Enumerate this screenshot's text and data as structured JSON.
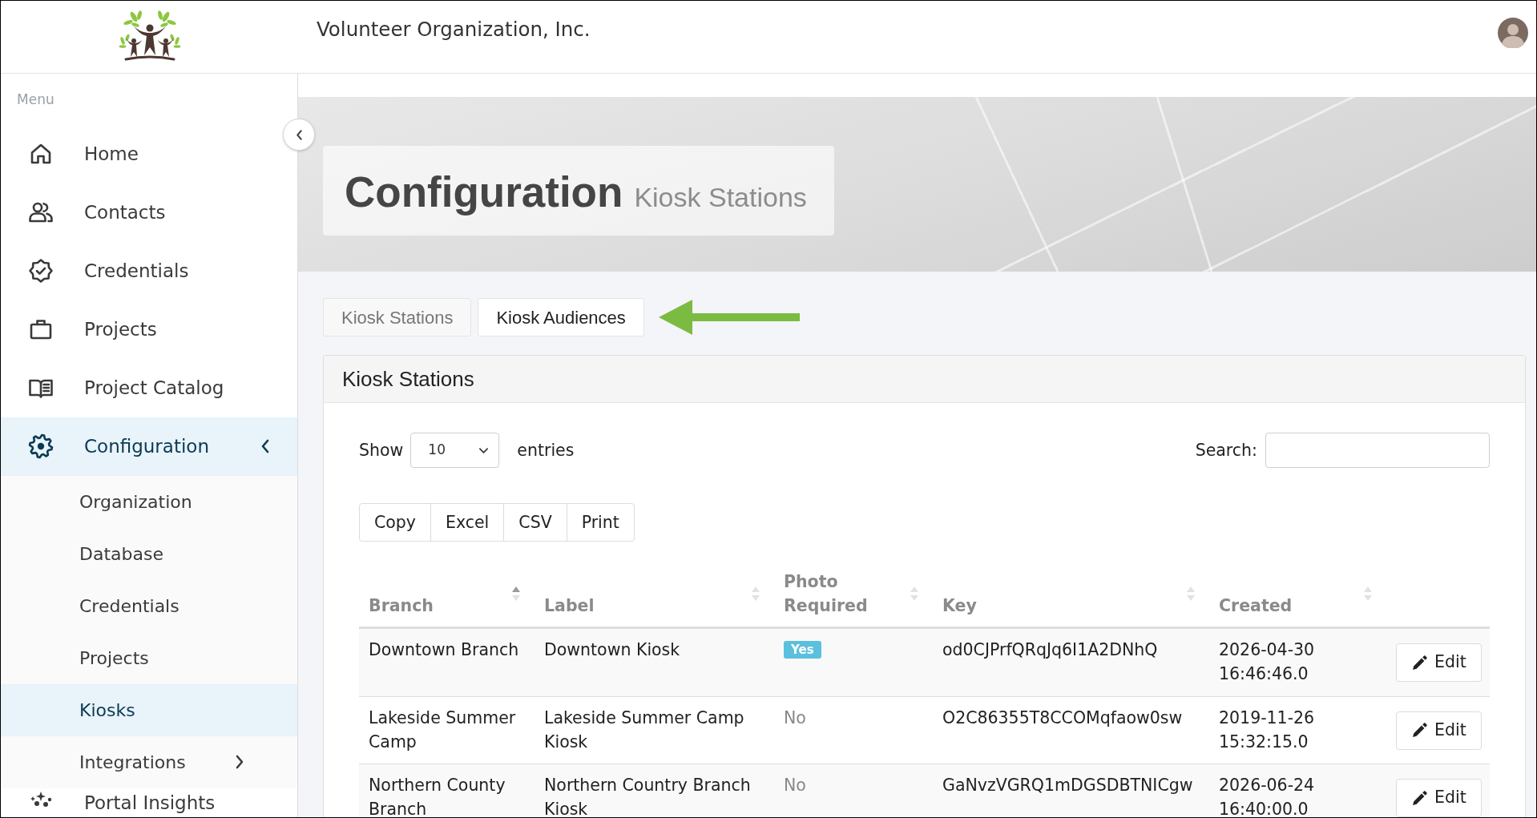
{
  "header": {
    "organization": "Volunteer Organization, Inc."
  },
  "sidebar": {
    "heading": "Menu",
    "items": [
      {
        "label": "Home",
        "selected": false
      },
      {
        "label": "Contacts",
        "selected": false
      },
      {
        "label": "Credentials",
        "selected": false
      },
      {
        "label": "Projects",
        "selected": false
      },
      {
        "label": "Project Catalog",
        "selected": false
      },
      {
        "label": "Configuration",
        "selected": true,
        "expanded": true,
        "children": [
          {
            "label": "Organization",
            "selected": false
          },
          {
            "label": "Database",
            "selected": false
          },
          {
            "label": "Credentials",
            "selected": false
          },
          {
            "label": "Projects",
            "selected": false
          },
          {
            "label": "Kiosks",
            "selected": true
          },
          {
            "label": "Integrations",
            "selected": false,
            "expanded": false
          }
        ]
      },
      {
        "label": "Portal Insights",
        "selected": false
      }
    ]
  },
  "page": {
    "title": "Configuration",
    "subtitle": "Kiosk Stations"
  },
  "tabs": [
    {
      "label": "Kiosk Stations",
      "selected": true
    },
    {
      "label": "Kiosk Audiences",
      "selected": false
    }
  ],
  "panel": {
    "title": "Kiosk Stations",
    "length_menu": {
      "label_before": "Show",
      "value": "10",
      "label_after": "entries"
    },
    "search": {
      "label": "Search:"
    },
    "buttons": [
      "Copy",
      "Excel",
      "CSV",
      "Print"
    ],
    "table": {
      "columns": [
        {
          "label": "Branch",
          "sorted": true
        },
        {
          "label": "Label",
          "sorted": false
        },
        {
          "label": "Photo Required",
          "sorted": false
        },
        {
          "label": "Key",
          "sorted": false
        },
        {
          "label": "Created",
          "sorted": false
        }
      ],
      "rows": [
        {
          "branch": "Downtown Branch",
          "label": "Downtown Kiosk",
          "photo_required": {
            "text": "Yes",
            "kind": "badge"
          },
          "key": "od0CJPrfQRqJq6I1A2DNhQ",
          "created": "2026-04-30 16:46:46.0",
          "action": "Edit"
        },
        {
          "branch": "Lakeside Summer Camp",
          "label": "Lakeside Summer Camp Kiosk",
          "photo_required": {
            "text": "No",
            "kind": "plain"
          },
          "key": "O2C86355T8CCOMqfaow0sw",
          "created": "2019-11-26 15:32:15.0",
          "action": "Edit"
        },
        {
          "branch": "Northern County Branch",
          "label": "Northern Country Branch Kiosk",
          "photo_required": {
            "text": "No",
            "kind": "plain"
          },
          "key": "GaNvzVGRQ1mDGSDBTNICgw",
          "created": "2026-06-24 16:40:00.0",
          "action": "Edit"
        }
      ]
    }
  }
}
